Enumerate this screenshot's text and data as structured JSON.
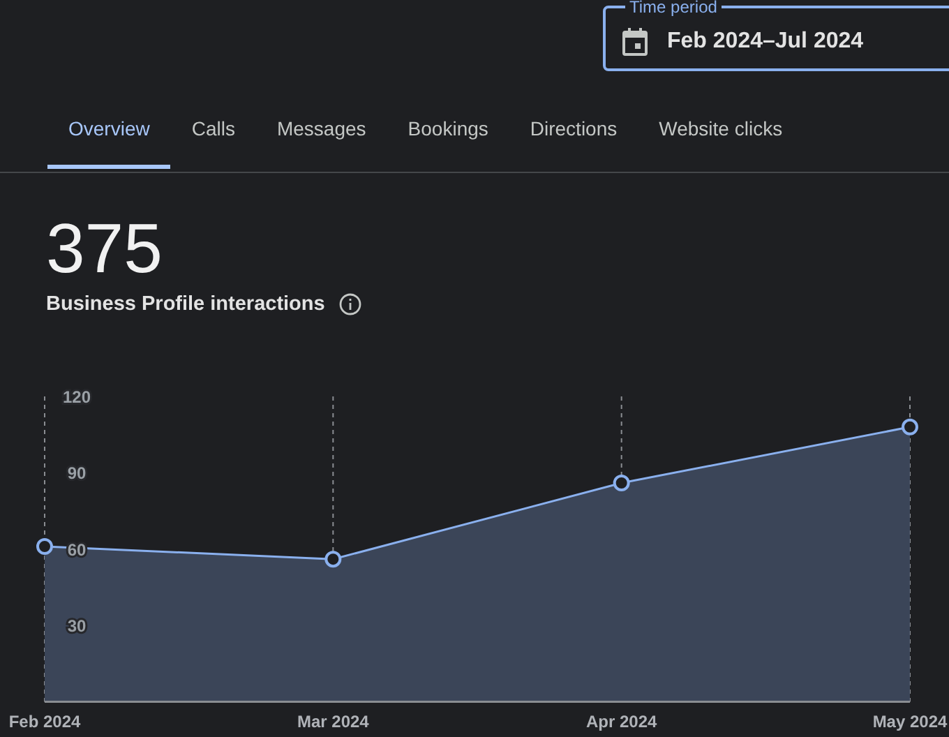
{
  "time_period": {
    "label": "Time period",
    "value": "Feb 2024–Jul 2024"
  },
  "tabs": [
    {
      "label": "Overview",
      "selected": true
    },
    {
      "label": "Calls",
      "selected": false
    },
    {
      "label": "Messages",
      "selected": false
    },
    {
      "label": "Bookings",
      "selected": false
    },
    {
      "label": "Directions",
      "selected": false
    },
    {
      "label": "Website clicks",
      "selected": false
    }
  ],
  "metric": {
    "value": "375",
    "label": "Business Profile interactions"
  },
  "chart_data": {
    "type": "area",
    "categories": [
      "Feb 2024",
      "Mar 2024",
      "Apr 2024",
      "May 2024"
    ],
    "values": [
      61,
      56,
      86,
      108
    ],
    "ylim": [
      0,
      120
    ],
    "yticks": [
      30,
      60,
      90,
      120
    ]
  }
}
